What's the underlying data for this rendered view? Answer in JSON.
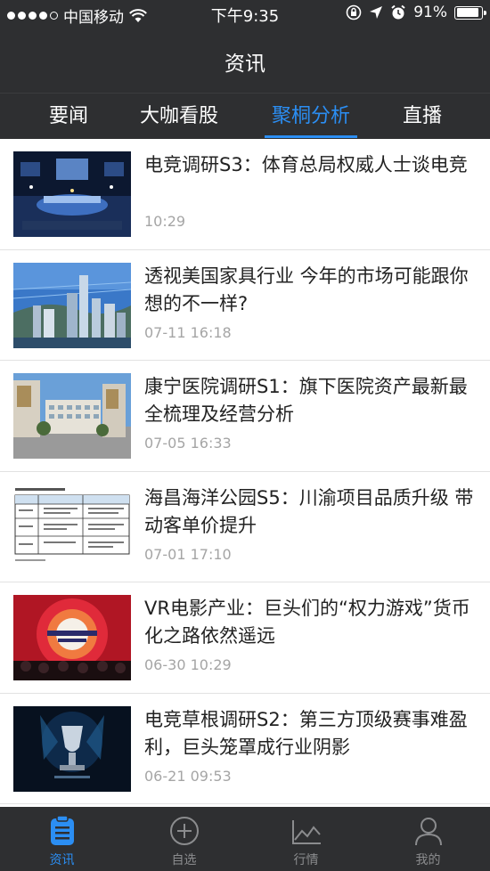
{
  "status_bar": {
    "carrier": "中国移动",
    "time": "下午9:35",
    "battery": "91%",
    "battery_level": 0.91
  },
  "header": {
    "title": "资讯"
  },
  "tabs": [
    {
      "label": "要闻",
      "active": false
    },
    {
      "label": "大咖看股",
      "active": false
    },
    {
      "label": "聚桐分析",
      "active": true
    },
    {
      "label": "直播",
      "active": false
    }
  ],
  "news": [
    {
      "title": "电竞调研S3：体育总局权威人士谈电竞",
      "time": "10:29",
      "thumb": "esports-arena-photo"
    },
    {
      "title": "透视美国家具行业 今年的市场可能跟你想的不一样?",
      "time": "07-11 16:18",
      "thumb": "city-skyline-photo"
    },
    {
      "title": "康宁医院调研S1：旗下医院资产最新最全梳理及经营分析",
      "time": "07-05 16:33",
      "thumb": "hospital-building-photo"
    },
    {
      "title": "海昌海洋公园S5：川渝项目品质升级 带动客单价提升",
      "time": "07-01 17:10",
      "thumb": "table-document-image"
    },
    {
      "title": "VR电影产业：巨头们的“权力游戏”货币化之路依然遥远",
      "time": "06-30 10:29",
      "thumb": "vr-conference-photo"
    },
    {
      "title": "电竞草根调研S2：第三方顶级赛事难盈利，巨头笼罩成行业阴影",
      "time": "06-21 09:53",
      "thumb": "trophy-photo"
    }
  ],
  "bottom_tabs": [
    {
      "label": "资讯",
      "icon": "news-clipboard-icon",
      "active": true
    },
    {
      "label": "自选",
      "icon": "plus-circle-icon",
      "active": false
    },
    {
      "label": "行情",
      "icon": "chart-line-icon",
      "active": false
    },
    {
      "label": "我的",
      "icon": "user-profile-icon",
      "active": false
    }
  ],
  "colors": {
    "bar_bg": "#2e2f31",
    "accent": "#2b8ef3",
    "time_gray": "#a5a5a5"
  }
}
